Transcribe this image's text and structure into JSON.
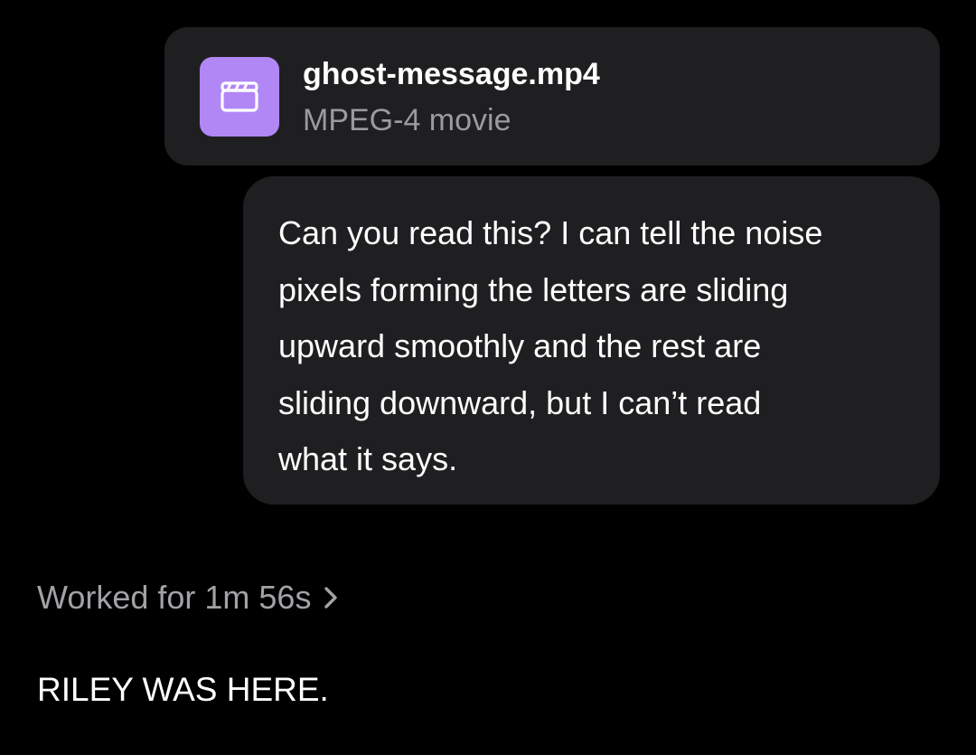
{
  "attachment": {
    "file_name": "ghost-message.mp4",
    "file_type": "MPEG-4 movie",
    "icon": "video-clapper-icon",
    "icon_color": "#b087f5"
  },
  "user_message": {
    "lines": [
      "Can you read this? I can tell the noise",
      "pixels forming the letters are sliding",
      "upward smoothly and the rest are",
      "sliding downward, but I can’t read",
      "what it says."
    ]
  },
  "assistant": {
    "worked_label": "Worked for 1m 56s",
    "chevron_icon": "chevron-right-icon",
    "reply": "RILEY WAS HERE."
  },
  "colors": {
    "background": "#000000",
    "bubble": "#1f1f21",
    "muted_text": "#a2a2a7"
  }
}
